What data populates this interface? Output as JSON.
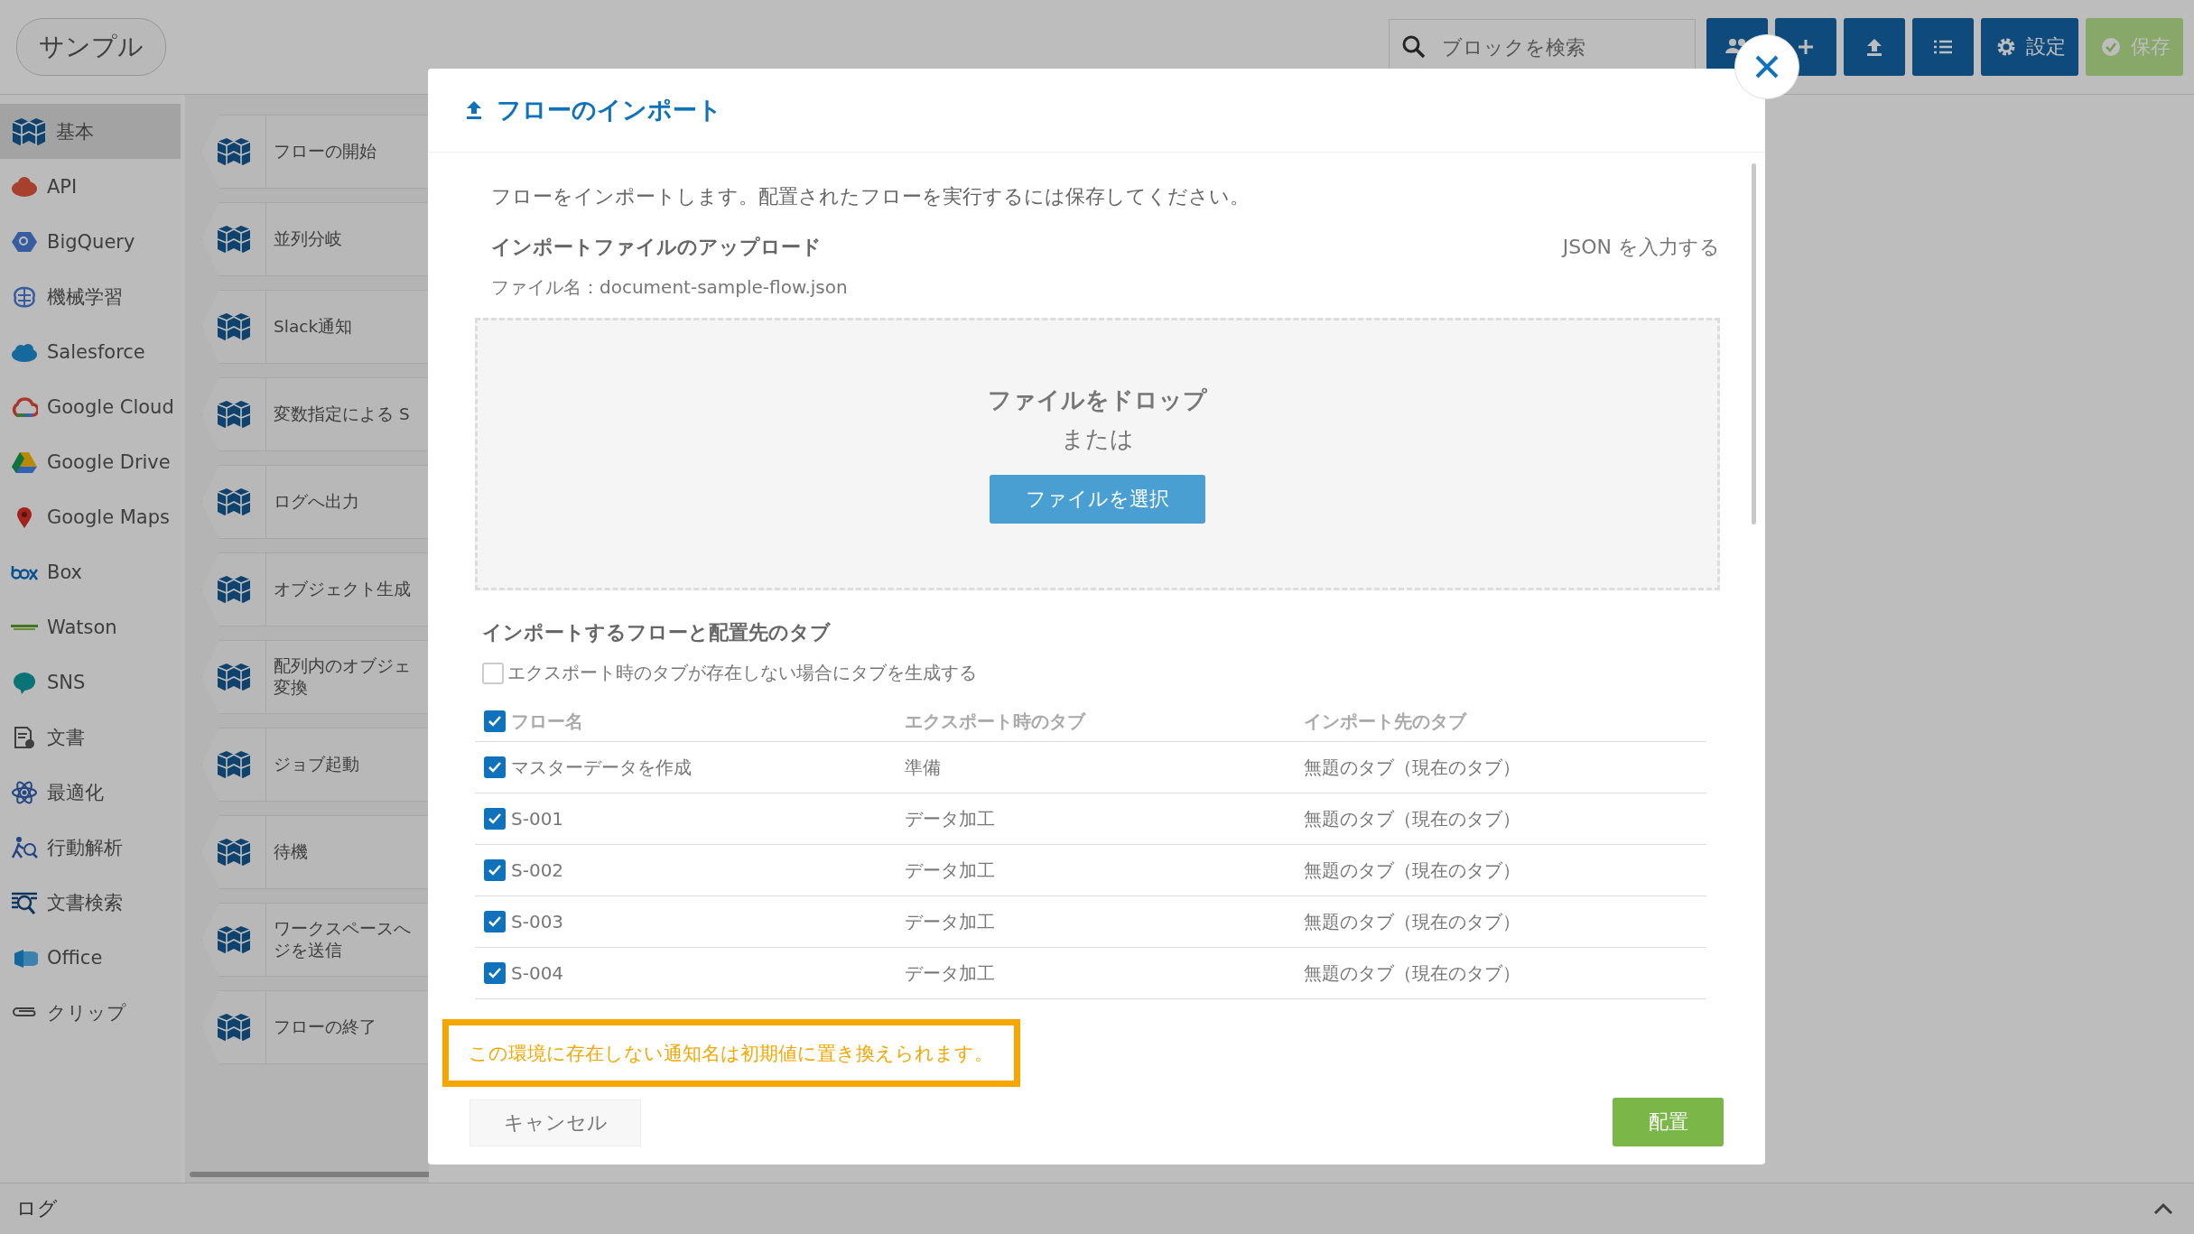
{
  "header": {
    "title": "サンプル",
    "search": {
      "placeholder": "ブロックを検索"
    },
    "buttons": [
      {
        "kind": "users",
        "disabled": false
      },
      {
        "kind": "add",
        "disabled": false
      },
      {
        "kind": "upload",
        "disabled": false
      },
      {
        "kind": "list",
        "disabled": false
      },
      {
        "kind": "settings",
        "label": "設定",
        "disabled": false
      },
      {
        "kind": "save",
        "label": "保存",
        "disabled": true
      }
    ]
  },
  "sidebar": {
    "items": [
      {
        "label": "基本",
        "selected": true
      },
      {
        "label": "API",
        "selected": false
      },
      {
        "label": "BigQuery",
        "selected": false
      },
      {
        "label": "機械学習",
        "selected": false
      },
      {
        "label": "Salesforce",
        "selected": false
      },
      {
        "label": "Google Cloud",
        "selected": false
      },
      {
        "label": "Google Drive",
        "selected": false
      },
      {
        "label": "Google Maps",
        "selected": false
      },
      {
        "label": "Box",
        "selected": false
      },
      {
        "label": "Watson",
        "selected": false
      },
      {
        "label": "SNS",
        "selected": false
      },
      {
        "label": "文書",
        "selected": false
      },
      {
        "label": "最適化",
        "selected": false
      },
      {
        "label": "行動解析",
        "selected": false
      },
      {
        "label": "文書検索",
        "selected": false
      },
      {
        "label": "Office",
        "selected": false
      },
      {
        "label": "クリップ",
        "selected": false
      }
    ]
  },
  "blocks": [
    {
      "lines": [
        "フローの開始"
      ]
    },
    {
      "lines": [
        "並列分岐"
      ]
    },
    {
      "lines": [
        "Slack通知"
      ]
    },
    {
      "lines": [
        "変数指定による S"
      ]
    },
    {
      "lines": [
        "ログへ出力"
      ]
    },
    {
      "lines": [
        "オブジェクト生成"
      ]
    },
    {
      "lines": [
        "配列内のオブジェ",
        "変換"
      ]
    },
    {
      "lines": [
        "ジョブ起動"
      ]
    },
    {
      "lines": [
        "待機"
      ]
    },
    {
      "lines": [
        "ワークスペースへ",
        "ジを送信"
      ]
    },
    {
      "lines": [
        "フローの終了"
      ]
    }
  ],
  "modal": {
    "title": "フローのインポート",
    "description": "フローをインポートします。配置されたフローを実行するには保存してください。",
    "upload_heading": "インポートファイルのアップロード",
    "json_link": "JSON を入力する",
    "file_name": "ファイル名：document-sample-flow.json",
    "dropzone": {
      "title": "ファイルをドロップ",
      "or": "または",
      "button": "ファイルを選択"
    },
    "tabs_heading": "インポートするフローと配置先のタブ",
    "create_tabs": {
      "label": "エクスポート時のタブが存在しない場合にタブを生成する",
      "checked": false
    },
    "table": {
      "all_checked": true,
      "columns": [
        "フロー名",
        "エクスポート時のタブ",
        "インポート先のタブ"
      ],
      "rows": [
        {
          "checked": true,
          "name": "マスターデータを作成",
          "export_tab": "準備",
          "import_tab": "無題のタブ（現在のタブ）"
        },
        {
          "checked": true,
          "name": "S-001",
          "export_tab": "データ加工",
          "import_tab": "無題のタブ（現在のタブ）"
        },
        {
          "checked": true,
          "name": "S-002",
          "export_tab": "データ加工",
          "import_tab": "無題のタブ（現在のタブ）"
        },
        {
          "checked": true,
          "name": "S-003",
          "export_tab": "データ加工",
          "import_tab": "無題のタブ（現在のタブ）"
        },
        {
          "checked": true,
          "name": "S-004",
          "export_tab": "データ加工",
          "import_tab": "無題のタブ（現在のタブ）"
        }
      ]
    },
    "notice": "この環境に存在しない通知名は初期値に置き換えられます。",
    "cancel": "キャンセル",
    "submit": "配置"
  },
  "log_bar": {
    "label": "ログ"
  }
}
